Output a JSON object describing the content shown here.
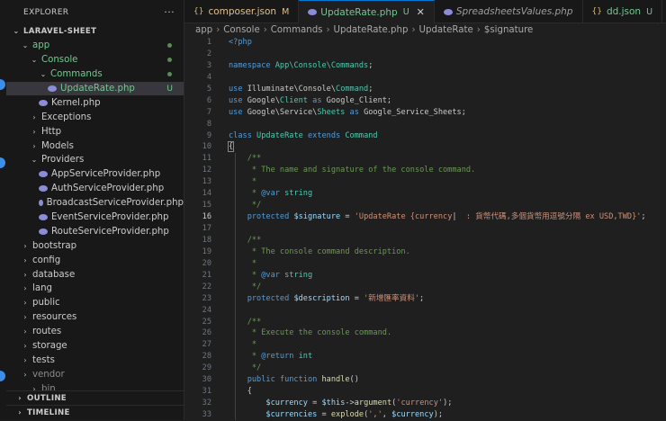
{
  "explorer": {
    "title": "EXPLORER",
    "more": "···",
    "project": "LARAVEL-SHEET",
    "tree": [
      {
        "label": "app",
        "depth": 1,
        "type": "folder",
        "open": true,
        "mark": "dot"
      },
      {
        "label": "Console",
        "depth": 2,
        "type": "folder",
        "open": true,
        "mark": "dot"
      },
      {
        "label": "Commands",
        "depth": 3,
        "type": "folder",
        "open": true,
        "mark": "dot"
      },
      {
        "label": "UpdateRate.php",
        "depth": 4,
        "type": "php",
        "selected": true,
        "mark": "U"
      },
      {
        "label": "Kernel.php",
        "depth": 3,
        "type": "php"
      },
      {
        "label": "Exceptions",
        "depth": 2,
        "type": "folder"
      },
      {
        "label": "Http",
        "depth": 2,
        "type": "folder"
      },
      {
        "label": "Models",
        "depth": 2,
        "type": "folder"
      },
      {
        "label": "Providers",
        "depth": 2,
        "type": "folder",
        "open": true
      },
      {
        "label": "AppServiceProvider.php",
        "depth": 3,
        "type": "php"
      },
      {
        "label": "AuthServiceProvider.php",
        "depth": 3,
        "type": "php"
      },
      {
        "label": "BroadcastServiceProvider.php",
        "depth": 3,
        "type": "php"
      },
      {
        "label": "EventServiceProvider.php",
        "depth": 3,
        "type": "php"
      },
      {
        "label": "RouteServiceProvider.php",
        "depth": 3,
        "type": "php"
      },
      {
        "label": "bootstrap",
        "depth": 1,
        "type": "folder"
      },
      {
        "label": "config",
        "depth": 1,
        "type": "folder"
      },
      {
        "label": "database",
        "depth": 1,
        "type": "folder"
      },
      {
        "label": "lang",
        "depth": 1,
        "type": "folder"
      },
      {
        "label": "public",
        "depth": 1,
        "type": "folder"
      },
      {
        "label": "resources",
        "depth": 1,
        "type": "folder"
      },
      {
        "label": "routes",
        "depth": 1,
        "type": "folder"
      },
      {
        "label": "storage",
        "depth": 1,
        "type": "folder"
      },
      {
        "label": "tests",
        "depth": 1,
        "type": "folder"
      },
      {
        "label": "vendor",
        "depth": 1,
        "type": "folder",
        "muted": true
      },
      {
        "label": "bin",
        "depth": 2,
        "type": "folder",
        "muted": true
      }
    ],
    "outline": "OUTLINE",
    "timeline": "TIMELINE"
  },
  "tabs": [
    {
      "icon": "{}",
      "label": "composer.json",
      "mark": "M",
      "active": false,
      "italic": false
    },
    {
      "icon": "php",
      "label": "UpdateRate.php",
      "mark": "U",
      "active": true,
      "italic": false,
      "close": "✕"
    },
    {
      "icon": "php",
      "label": "SpreadsheetsValues.php",
      "mark": "",
      "active": false,
      "italic": true
    },
    {
      "icon": "{}",
      "label": "dd.json",
      "mark": "U",
      "active": false,
      "italic": false
    }
  ],
  "breadcrumb": [
    "app",
    "Console",
    "Commands",
    "UpdateRate.php",
    "UpdateRate",
    "$signature"
  ],
  "editor": {
    "current_line": 16,
    "lines": [
      [
        [
          "tag",
          "<?php"
        ]
      ],
      [],
      [
        [
          "k",
          "namespace "
        ],
        [
          "cls",
          "App\\Console\\Commands"
        ],
        [
          "src",
          ";"
        ]
      ],
      [],
      [
        [
          "k",
          "use "
        ],
        [
          "src",
          "Illuminate\\Console\\"
        ],
        [
          "cls",
          "Command"
        ],
        [
          "src",
          ";"
        ]
      ],
      [
        [
          "k",
          "use "
        ],
        [
          "src",
          "Google\\"
        ],
        [
          "cls",
          "Client"
        ],
        [
          "k",
          " as "
        ],
        [
          "src",
          "Google_Client;"
        ]
      ],
      [
        [
          "k",
          "use "
        ],
        [
          "src",
          "Google\\Service\\"
        ],
        [
          "cls",
          "Sheets"
        ],
        [
          "k",
          " as "
        ],
        [
          "src",
          "Google_Service_Sheets;"
        ]
      ],
      [],
      [
        [
          "k",
          "class "
        ],
        [
          "cls",
          "UpdateRate"
        ],
        [
          "k",
          " extends "
        ],
        [
          "cls",
          "Command"
        ]
      ],
      [
        [
          "brk",
          "{"
        ]
      ],
      [
        [
          "cm",
          "    /**"
        ]
      ],
      [
        [
          "cm",
          "     * The name and signature of the console command."
        ]
      ],
      [
        [
          "cm",
          "     *"
        ]
      ],
      [
        [
          "cm",
          "     * "
        ],
        [
          "k",
          "@var "
        ],
        [
          "cls",
          "string"
        ]
      ],
      [
        [
          "cm",
          "     */"
        ]
      ],
      [
        [
          "k",
          "    protected "
        ],
        [
          "var",
          "$signature"
        ],
        [
          "src",
          " = "
        ],
        [
          "str",
          "'UpdateRate {currency"
        ],
        [
          "src",
          "|"
        ],
        [
          "str",
          "  : 貨幣代碼,多個貨幣用逗號分隔 ex USD,TWD}'"
        ],
        [
          "src",
          ";"
        ]
      ],
      [],
      [
        [
          "cm",
          "    /**"
        ]
      ],
      [
        [
          "cm",
          "     * The console command description."
        ]
      ],
      [
        [
          "cm",
          "     *"
        ]
      ],
      [
        [
          "cm",
          "     * "
        ],
        [
          "k",
          "@var "
        ],
        [
          "cls",
          "string"
        ]
      ],
      [
        [
          "cm",
          "     */"
        ]
      ],
      [
        [
          "k",
          "    protected "
        ],
        [
          "var",
          "$description"
        ],
        [
          "src",
          " = "
        ],
        [
          "str",
          "'新增匯率資料'"
        ],
        [
          "src",
          ";"
        ]
      ],
      [],
      [
        [
          "cm",
          "    /**"
        ]
      ],
      [
        [
          "cm",
          "     * Execute the console command."
        ]
      ],
      [
        [
          "cm",
          "     *"
        ]
      ],
      [
        [
          "cm",
          "     * "
        ],
        [
          "k",
          "@return "
        ],
        [
          "cls",
          "int"
        ]
      ],
      [
        [
          "cm",
          "     */"
        ]
      ],
      [
        [
          "k",
          "    public function "
        ],
        [
          "fn",
          "handle"
        ],
        [
          "src",
          "()"
        ]
      ],
      [
        [
          "src",
          "    {"
        ]
      ],
      [
        [
          "var",
          "        $currency"
        ],
        [
          "src",
          " = "
        ],
        [
          "var",
          "$this"
        ],
        [
          "src",
          "->"
        ],
        [
          "fn",
          "argument"
        ],
        [
          "src",
          "("
        ],
        [
          "str",
          "'currency'"
        ],
        [
          "src",
          ");"
        ]
      ],
      [
        [
          "var",
          "        $currencies"
        ],
        [
          "src",
          " = "
        ],
        [
          "fn",
          "explode"
        ],
        [
          "src",
          "("
        ],
        [
          "str",
          "','"
        ],
        [
          "src",
          ", "
        ],
        [
          "var",
          "$currency"
        ],
        [
          "src",
          ");"
        ]
      ]
    ]
  }
}
